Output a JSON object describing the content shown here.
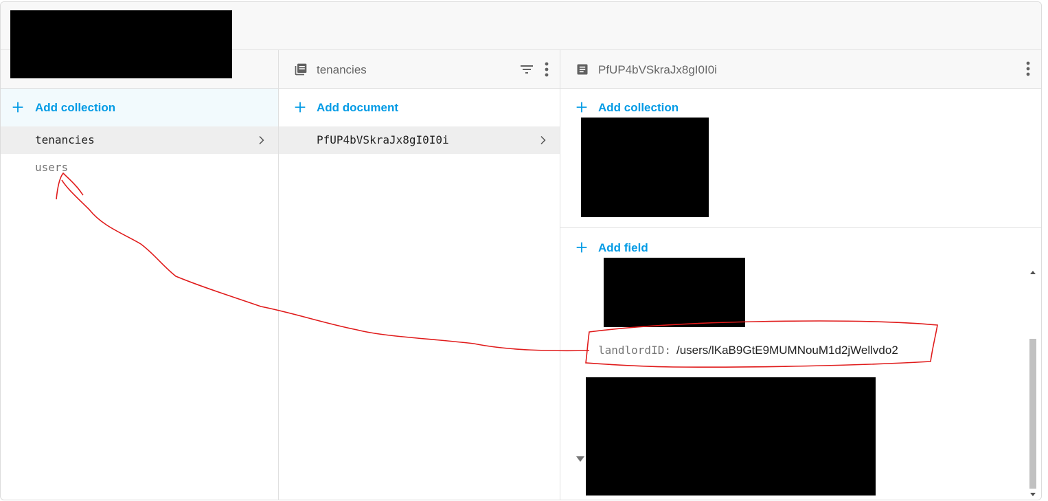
{
  "collections_panel": {
    "add_label": "Add collection",
    "items": [
      {
        "label": "tenancies"
      },
      {
        "label": "users"
      }
    ]
  },
  "documents_panel": {
    "title": "tenancies",
    "add_label": "Add document",
    "items": [
      {
        "label": "PfUP4bVSkraJx8gI0I0i"
      }
    ]
  },
  "document_panel": {
    "title": "PfUP4bVSkraJx8gI0I0i",
    "add_collection_label": "Add collection",
    "add_field_label": "Add field",
    "field": {
      "key": "landlordID:",
      "value": "/users/lKaB9GtE9MUMNouM1d2jWellvdo2"
    }
  },
  "colors": {
    "accent": "#039be5",
    "annotation": "#e01b1b"
  }
}
